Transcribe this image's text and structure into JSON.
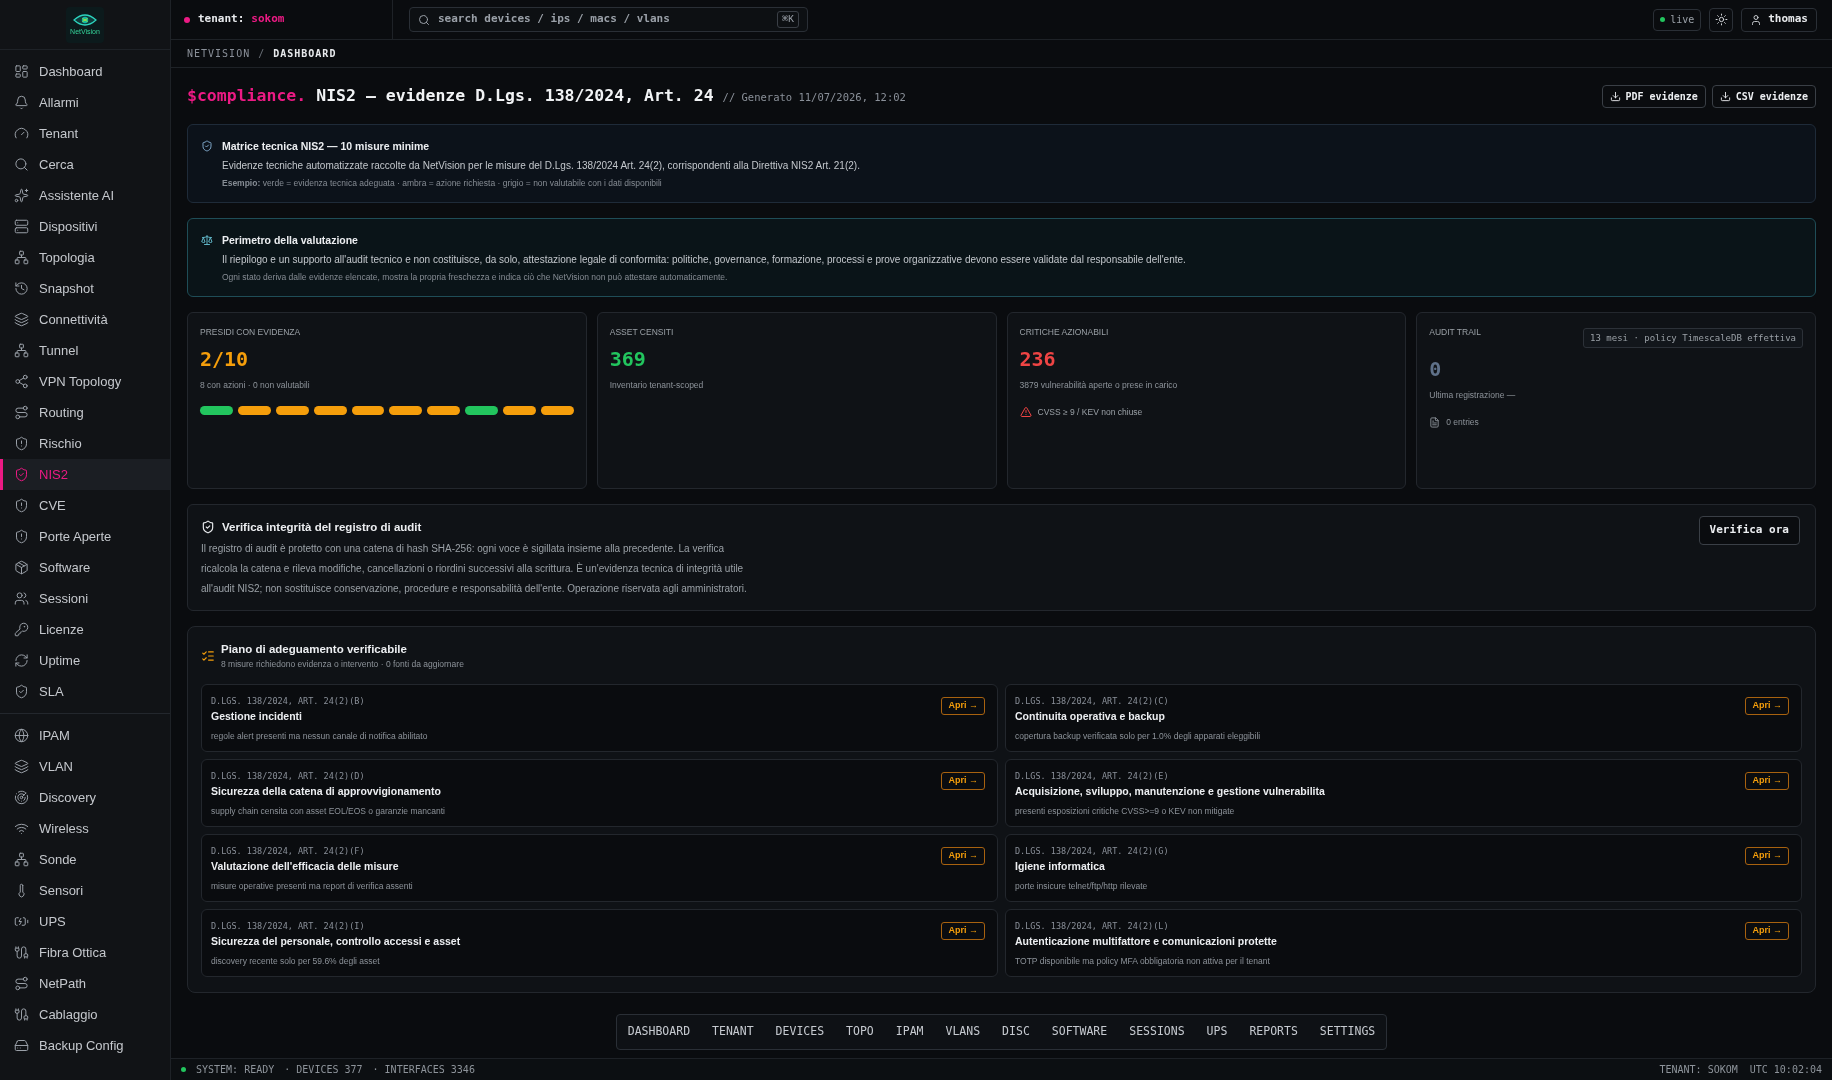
{
  "sidebar": {
    "logo": "NetVision",
    "groups": [
      {
        "items": [
          {
            "label": "Dashboard",
            "selected": false
          },
          {
            "label": "Allarmi",
            "selected": false
          },
          {
            "label": "Tenant",
            "selected": false
          },
          {
            "label": "Cerca",
            "selected": false
          },
          {
            "label": "Assistente AI",
            "selected": false
          },
          {
            "label": "Dispositivi",
            "selected": false
          },
          {
            "label": "Topologia",
            "selected": false
          },
          {
            "label": "Snapshot",
            "selected": false
          },
          {
            "label": "Connettività",
            "selected": false
          },
          {
            "label": "Tunnel",
            "selected": false
          },
          {
            "label": "VPN Topology",
            "selected": false
          },
          {
            "label": "Routing",
            "selected": false
          },
          {
            "label": "Rischio",
            "selected": false
          },
          {
            "label": "NIS2",
            "selected": true
          },
          {
            "label": "CVE",
            "selected": false
          },
          {
            "label": "Porte Aperte",
            "selected": false
          },
          {
            "label": "Software",
            "selected": false
          },
          {
            "label": "Sessioni",
            "selected": false
          },
          {
            "label": "Licenze",
            "selected": false
          },
          {
            "label": "Uptime",
            "selected": false
          },
          {
            "label": "SLA",
            "selected": false
          }
        ]
      },
      {
        "items": [
          {
            "label": "IPAM",
            "selected": false
          },
          {
            "label": "VLAN",
            "selected": false
          },
          {
            "label": "Discovery",
            "selected": false
          },
          {
            "label": "Wireless",
            "selected": false
          },
          {
            "label": "Sonde",
            "selected": false
          },
          {
            "label": "Sensori",
            "selected": false
          },
          {
            "label": "UPS",
            "selected": false
          },
          {
            "label": "Fibra Ottica",
            "selected": false
          },
          {
            "label": "NetPath",
            "selected": false
          },
          {
            "label": "Cablaggio",
            "selected": false
          },
          {
            "label": "Backup Config",
            "selected": false
          }
        ]
      }
    ]
  },
  "header": {
    "tenant_label": "tenant:",
    "tenant": "sokom",
    "search": {
      "placeholder": "search devices / ips / macs / vlans",
      "shortcut": "⌘K"
    },
    "live": "live",
    "user": "thomas"
  },
  "breadcrumb": {
    "separator": "/",
    "items": [
      {
        "label": "NETVISION",
        "current": false
      },
      {
        "label": "DASHBOARD",
        "current": true
      }
    ]
  },
  "page": {
    "prefix": "$compliance.",
    "title": "NIS2 — evidenze D.Lgs. 138/2024, Art. 24",
    "generated": "// Generato 11/07/2026, 12:02",
    "actions": [
      "PDF evidenze",
      "CSV evidenze"
    ]
  },
  "notices": [
    {
      "kind": "info",
      "title": "Matrice tecnica NIS2 — 10 misure minime",
      "text": "Evidenze tecniche automatizzate raccolte da NetVision per le misure del D.Lgs. 138/2024 Art. 24(2), corrispondenti alla Direttiva NIS2 Art. 21(2).",
      "note": "**Esempio:** verde = evidenza tecnica adeguata · ambra = azione richiesta · grigio = non valutabile con i dati disponibili"
    },
    {
      "kind": "scope",
      "title": "Perimetro della valutazione",
      "text": "Il riepilogo e un supporto all'audit tecnico e non costituisce, da solo, attestazione legale di conformita: politiche, governance, formazione, processi e prove organizzative devono essere validate dal responsabile dell'ente.",
      "note": "Ogni stato deriva dalle evidenze elencate, mostra la propria freschezza e indica ciò che NetVision non può attestare automaticamente."
    }
  ],
  "stats": [
    {
      "label": "PRESIDI CON EVIDENZA",
      "value": "2/10",
      "color": "#f59e0b",
      "detail": "8 con azioni · 0 non valutabili",
      "segments": [
        {
          "color": "#22c55e"
        },
        {
          "color": "#f59e0b"
        },
        {
          "color": "#f59e0b"
        },
        {
          "color": "#f59e0b"
        },
        {
          "color": "#f59e0b"
        },
        {
          "color": "#f59e0b"
        },
        {
          "color": "#f59e0b"
        },
        {
          "color": "#22c55e"
        },
        {
          "color": "#f59e0b"
        },
        {
          "color": "#f59e0b"
        }
      ]
    },
    {
      "label": "ASSET CENSITI",
      "value": "369",
      "color": "#22c55e",
      "detail": "Inventario tenant-scoped"
    },
    {
      "label": "CRITICHE AZIONABILI",
      "value": "236",
      "color": "#ef4444",
      "detail": "3879 vulnerabilità aperte o prese in carico",
      "alert": "CVSS ≥ 9 / KEV non chiuse"
    },
    {
      "label": "AUDIT TRAIL",
      "badge": "13 mesi · policy TimescaleDB effettiva",
      "value": "0",
      "color": "#5f7189",
      "detail": "Ultima registrazione —",
      "entries": "0 entries"
    }
  ],
  "audit_integrity": {
    "title": "Verifica integrità del registro di audit",
    "text": "Il registro di audit è protetto con una catena di hash SHA-256: ogni voce è sigillata insieme alla precedente. La verifica ricalcola la catena e rileva modifiche, cancellazioni o riordini successivi alla scrittura. È un'evidenza tecnica di integrità utile all'audit NIS2; non sostituisce conservazione, procedure e responsabilità dell'ente. Operazione riservata agli amministratori.",
    "action": "Verifica ora"
  },
  "plan": {
    "title": "Piano di adeguamento verificabile",
    "subtitle": "8 misure richiedono evidenza o intervento · 0 fonti da aggiornare",
    "measures": [
      {
        "ref": "D.LGS. 138/2024, ART. 24(2)(B)",
        "title": "Gestione incidenti",
        "detail": "regole alert presenti ma nessun canale di notifica abilitato",
        "action": "Apri →"
      },
      {
        "ref": "D.LGS. 138/2024, ART. 24(2)(C)",
        "title": "Continuita operativa e backup",
        "detail": "copertura backup verificata solo per 1.0% degli apparati eleggibili",
        "action": "Apri →"
      },
      {
        "ref": "D.LGS. 138/2024, ART. 24(2)(D)",
        "title": "Sicurezza della catena di approvvigionamento",
        "detail": "supply chain censita con asset EOL/EOS o garanzie mancanti",
        "action": "Apri →"
      },
      {
        "ref": "D.LGS. 138/2024, ART. 24(2)(E)",
        "title": "Acquisizione, sviluppo, manutenzione e gestione vulnerabilita",
        "detail": "presenti esposizioni critiche CVSS>=9 o KEV non mitigate",
        "action": "Apri →"
      },
      {
        "ref": "D.LGS. 138/2024, ART. 24(2)(F)",
        "title": "Valutazione dell'efficacia delle misure",
        "detail": "misure operative presenti ma report di verifica assenti",
        "action": "Apri →"
      },
      {
        "ref": "D.LGS. 138/2024, ART. 24(2)(G)",
        "title": "Igiene informatica",
        "detail": "porte insicure telnet/ftp/http rilevate",
        "action": "Apri →"
      },
      {
        "ref": "D.LGS. 138/2024, ART. 24(2)(I)",
        "title": "Sicurezza del personale, controllo accessi e asset",
        "detail": "discovery recente solo per 59.6% degli asset",
        "action": "Apri →"
      },
      {
        "ref": "D.LGS. 138/2024, ART. 24(2)(L)",
        "title": "Autenticazione multifattore e comunicazioni protette",
        "detail": "TOTP disponibile ma policy MFA obbligatoria non attiva per il tenant",
        "action": "Apri →"
      }
    ]
  },
  "bottom_nav": [
    "DASHBOARD",
    "TENANT",
    "DEVICES",
    "TOPO",
    "IPAM",
    "VLANS",
    "DISC",
    "SOFTWARE",
    "SESSIONS",
    "UPS",
    "REPORTS",
    "SETTINGS"
  ],
  "status_bar": {
    "left": [
      "SYSTEM: READY",
      "· DEVICES 377",
      "· INTERFACES 3346"
    ],
    "right": [
      "TENANT: SOKOM",
      "UTC 10:02:04"
    ]
  }
}
